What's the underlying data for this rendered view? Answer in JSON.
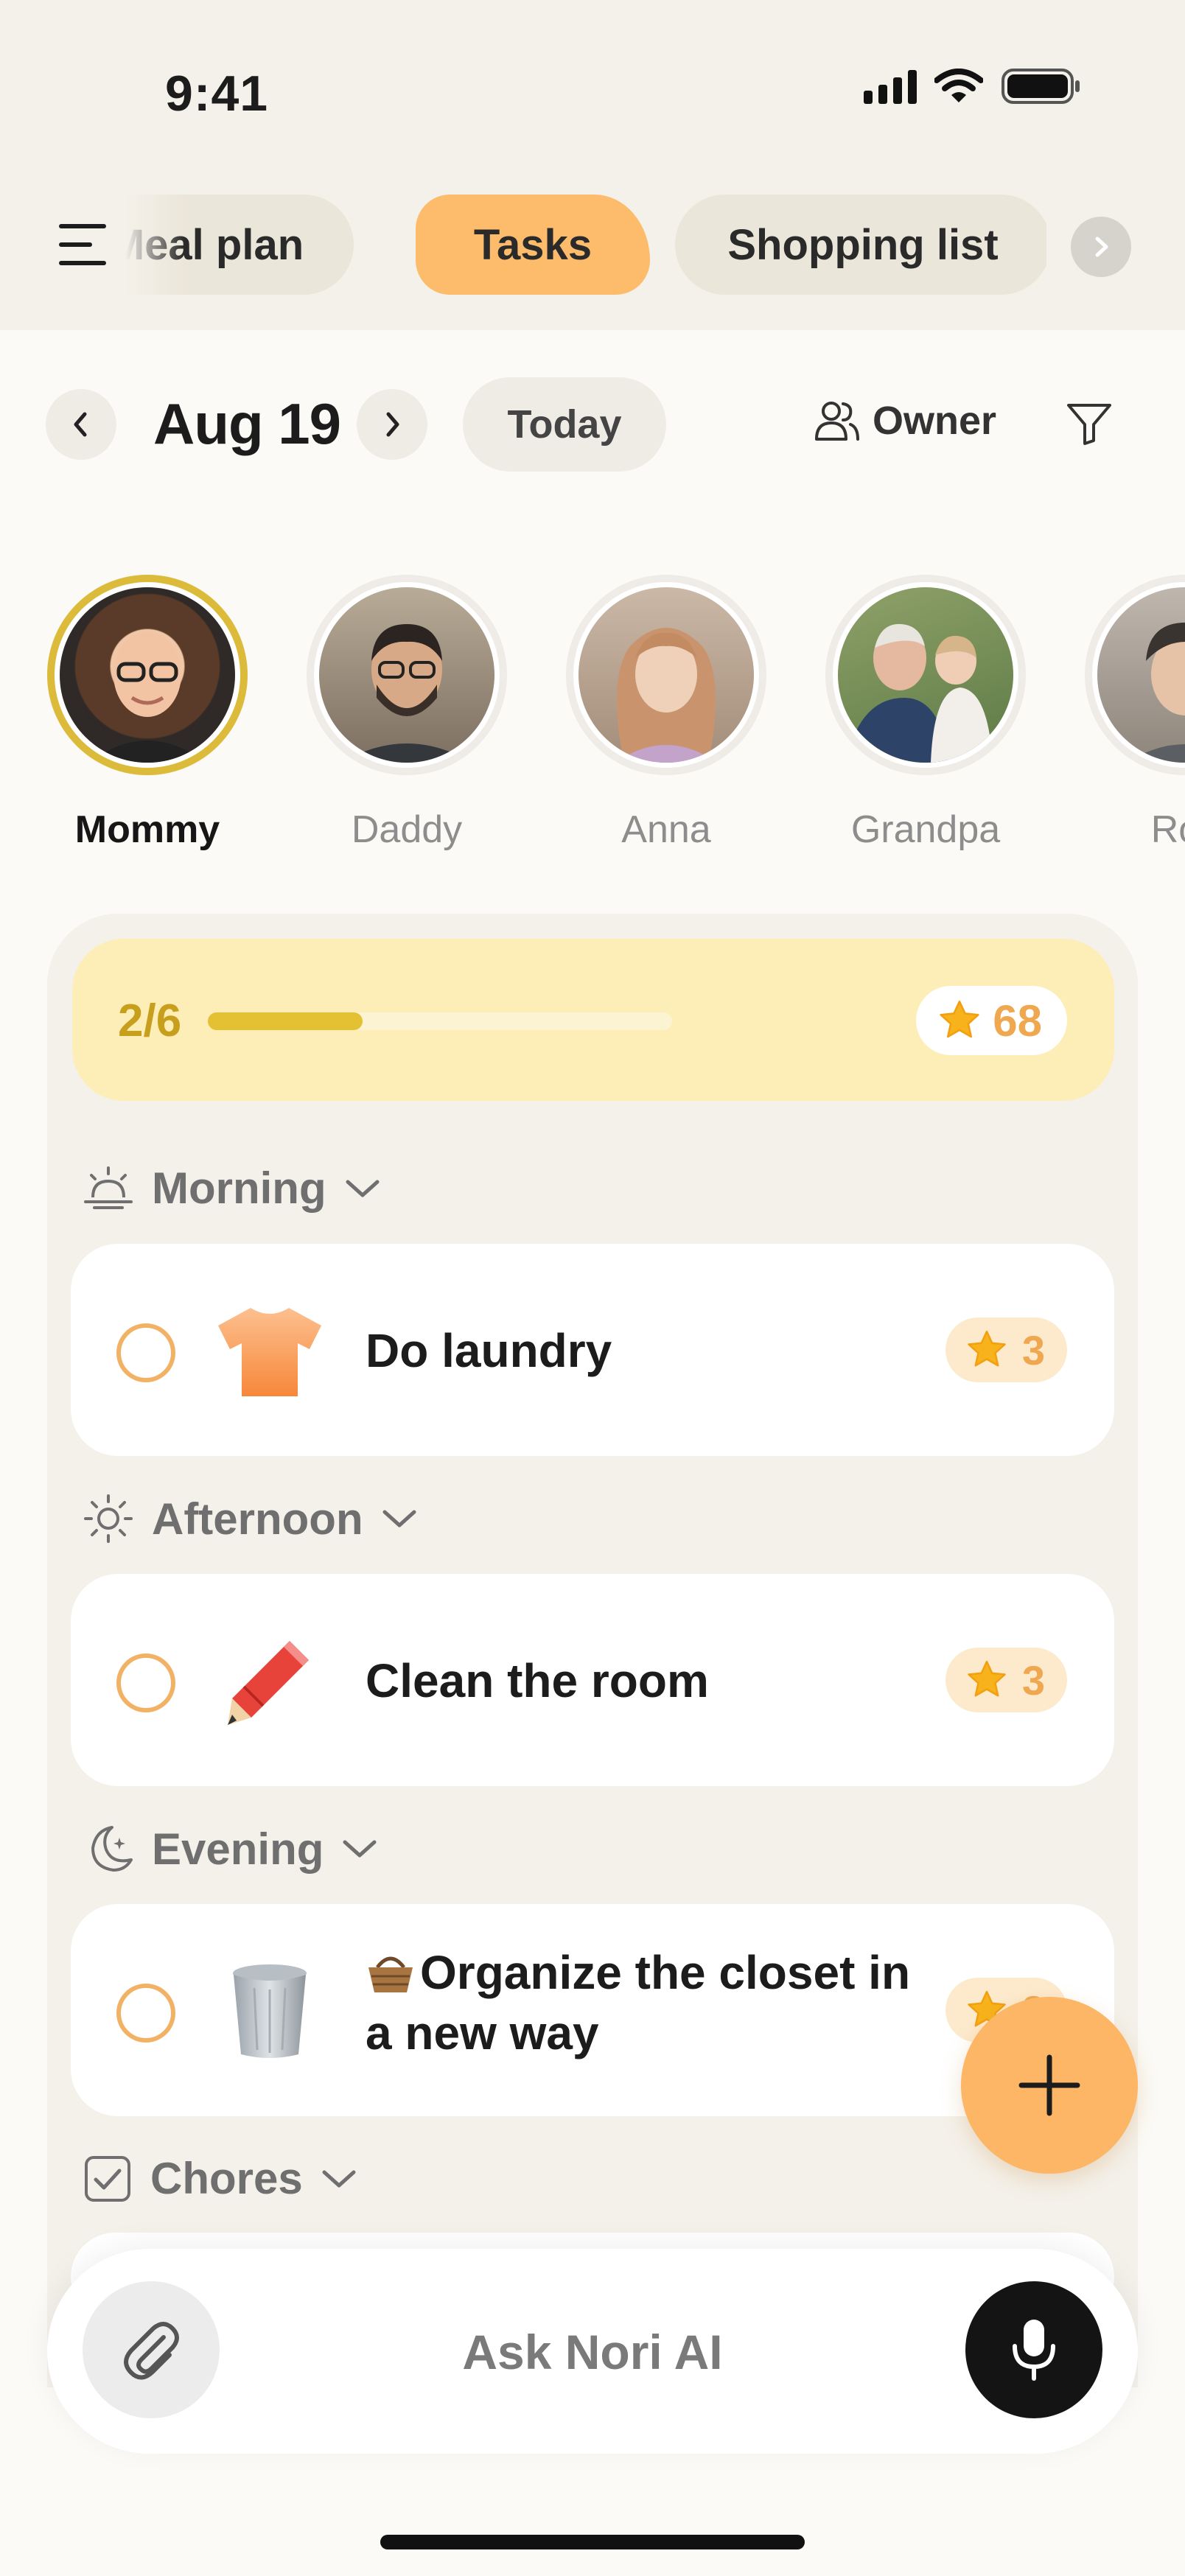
{
  "status_bar": {
    "time": "9:41"
  },
  "tabs": [
    {
      "label": "Meal plan",
      "active": false
    },
    {
      "label": "Tasks",
      "active": true
    },
    {
      "label": "Shopping list",
      "active": false
    }
  ],
  "date_nav": {
    "date": "Aug 19",
    "today_label": "Today",
    "owner_label": "Owner"
  },
  "members": [
    {
      "name": "Mommy",
      "selected": true
    },
    {
      "name": "Daddy",
      "selected": false
    },
    {
      "name": "Anna",
      "selected": false
    },
    {
      "name": "Grandpa",
      "selected": false
    },
    {
      "name": "Roc",
      "selected": false
    }
  ],
  "progress": {
    "label": "2/6",
    "fraction": 0.333,
    "points": "68"
  },
  "sections": [
    {
      "name": "Morning",
      "icon": "sunrise-icon",
      "tasks": [
        {
          "title": "Do laundry",
          "points": "3",
          "icon": "tshirt-icon"
        }
      ]
    },
    {
      "name": "Afternoon",
      "icon": "sun-icon",
      "tasks": [
        {
          "title": "Clean the room",
          "points": "3",
          "icon": "pencil-icon"
        }
      ]
    },
    {
      "name": "Evening",
      "icon": "moon-icon",
      "tasks": [
        {
          "title_line1": "Organize the closet in",
          "title_line2": "a new way",
          "points": "3",
          "icon": "trash-can-icon",
          "title_icon": "basket-icon"
        }
      ]
    },
    {
      "name": "Chores",
      "icon": "checkbox-icon",
      "tasks": []
    }
  ],
  "ask_bar": {
    "placeholder": "Ask Nori AI"
  },
  "colors": {
    "accent": "#fdb566",
    "progress_fill": "#e4c033",
    "points_text": "#efa84f",
    "selected_ring": "#dcbb3a"
  }
}
